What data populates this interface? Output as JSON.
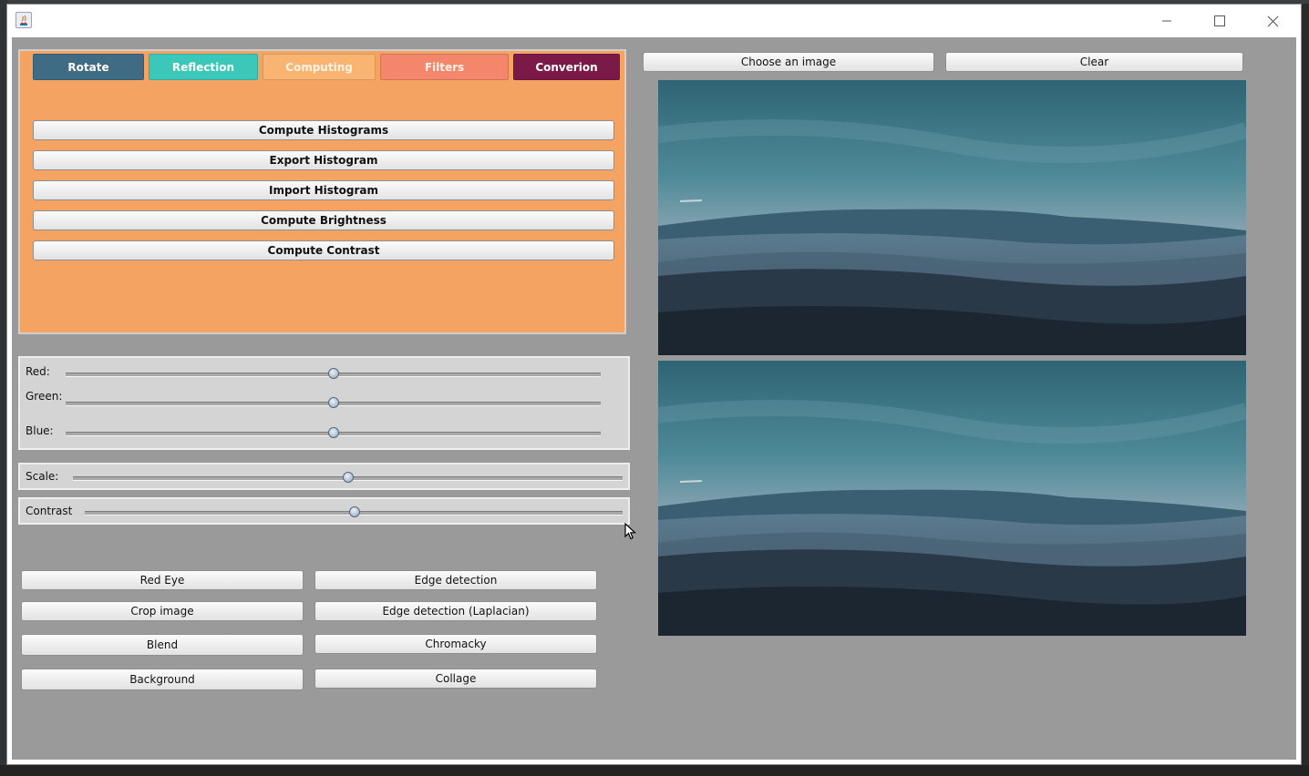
{
  "window": {
    "controls": [
      "minimize-icon",
      "maximize-icon",
      "close-icon"
    ]
  },
  "tabs": {
    "rotate": "Rotate",
    "reflection": "Reflection",
    "computing": "Computing",
    "filters": "Filters",
    "conversion": "Converion"
  },
  "computing_panel": {
    "buttons": [
      "Compute Histograms",
      "Export Histogram",
      "Import Histogram",
      "Compute Brightness",
      "Compute Contrast"
    ]
  },
  "rgb_sliders": {
    "red_label": "Red:",
    "green_label": "Green:",
    "blue_label": "Blue:",
    "red_value": 0.5,
    "green_value": 0.5,
    "blue_value": 0.5
  },
  "scale_slider": {
    "label": "Scale:",
    "value": 0.5
  },
  "contrast_slider": {
    "label": "Contrast",
    "value": 0.5
  },
  "operations": {
    "red_eye": "Red Eye",
    "edge_detection": "Edge detection",
    "crop_image": "Crop image",
    "edge_laplacian": "Edge detection (Laplacian)",
    "blend": "Blend",
    "chromacky": "Chromacky",
    "background": "Background",
    "collage": "Collage"
  },
  "image_toolbar": {
    "choose": "Choose an image",
    "clear": "Clear"
  },
  "images": {
    "original": "landscape-mountains-fog",
    "processed": "landscape-mountains-fog"
  },
  "colors": {
    "tool_panel": "#f4a362",
    "tab_rotate": "#3f6b84",
    "tab_reflection": "#3cc8b9",
    "tab_computing": "#f9b472",
    "tab_filters": "#f4866b",
    "tab_conversion": "#7b1a49",
    "client_background": "#9a9a9a"
  }
}
